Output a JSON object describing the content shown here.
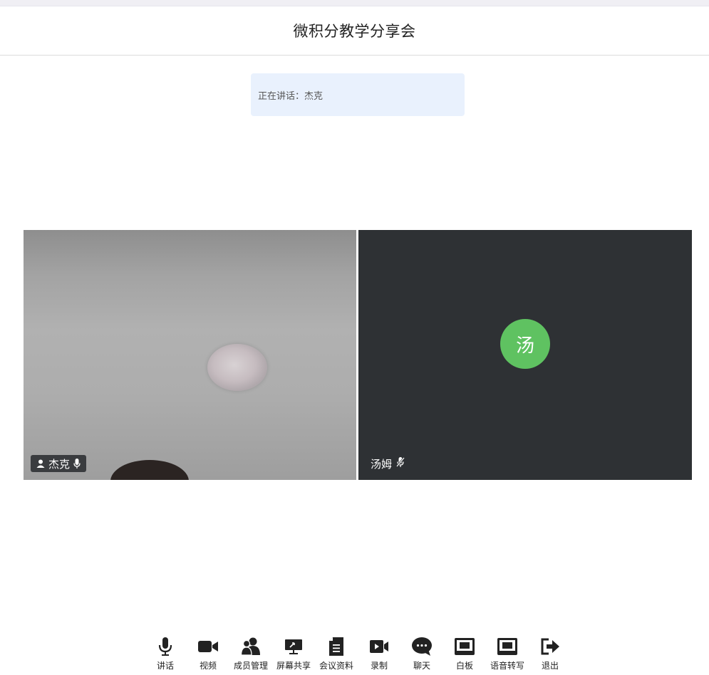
{
  "meeting": {
    "title": "微积分教学分享会"
  },
  "speaking": {
    "text": "正在讲话：杰克"
  },
  "participants": [
    {
      "name": "杰克",
      "video": true,
      "mic": "on"
    },
    {
      "name": "汤姆",
      "avatar_text": "汤",
      "avatar_color": "#5fc261",
      "video": false,
      "mic": "muted"
    }
  ],
  "toolbar": {
    "items": [
      {
        "label": "讲话",
        "icon": "microphone-icon"
      },
      {
        "label": "视频",
        "icon": "video-camera-icon"
      },
      {
        "label": "成员管理",
        "icon": "members-icon"
      },
      {
        "label": "屏幕共享",
        "icon": "screen-share-icon"
      },
      {
        "label": "会议资料",
        "icon": "document-icon"
      },
      {
        "label": "录制",
        "icon": "record-icon"
      },
      {
        "label": "聊天",
        "icon": "chat-bubble-icon"
      },
      {
        "label": "白板",
        "icon": "whiteboard-icon"
      },
      {
        "label": "语音转写",
        "icon": "transcription-icon"
      },
      {
        "label": "退出",
        "icon": "exit-icon"
      }
    ]
  }
}
